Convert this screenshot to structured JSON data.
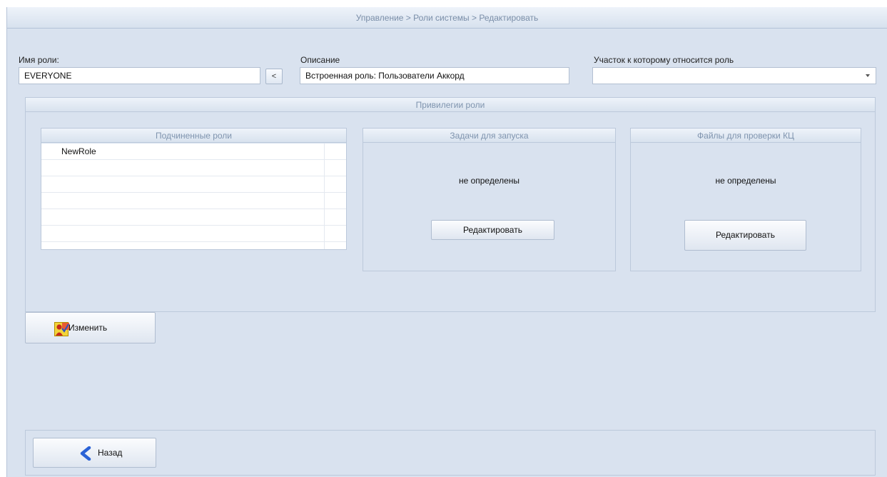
{
  "breadcrumb": "Управление > Роли системы > Редактировать",
  "role_name": {
    "label": "Имя роли:",
    "value": "EVERYONE",
    "btn_label": "<"
  },
  "description": {
    "label": "Описание",
    "value": "Встроенная роль: Пользователи Аккорд"
  },
  "section": {
    "label": "Участок к которому относится роль",
    "value": ""
  },
  "privileges": {
    "title": "Привилегии роли",
    "subroles": {
      "title": "Подчиненные роли",
      "items": [
        "NewRole",
        "",
        "",
        "",
        "",
        ""
      ]
    },
    "tasks": {
      "title": "Задачи для запуска",
      "status": "не определены",
      "edit_label": "Редактировать"
    },
    "files": {
      "title": "Файлы для проверки КЦ",
      "status": "не определены",
      "edit_label": "Редактировать"
    }
  },
  "change_button": {
    "label": "Изменить",
    "icon": "user-edit-icon"
  },
  "back_button": {
    "label": "Назад",
    "icon": "chevron-left-icon"
  }
}
